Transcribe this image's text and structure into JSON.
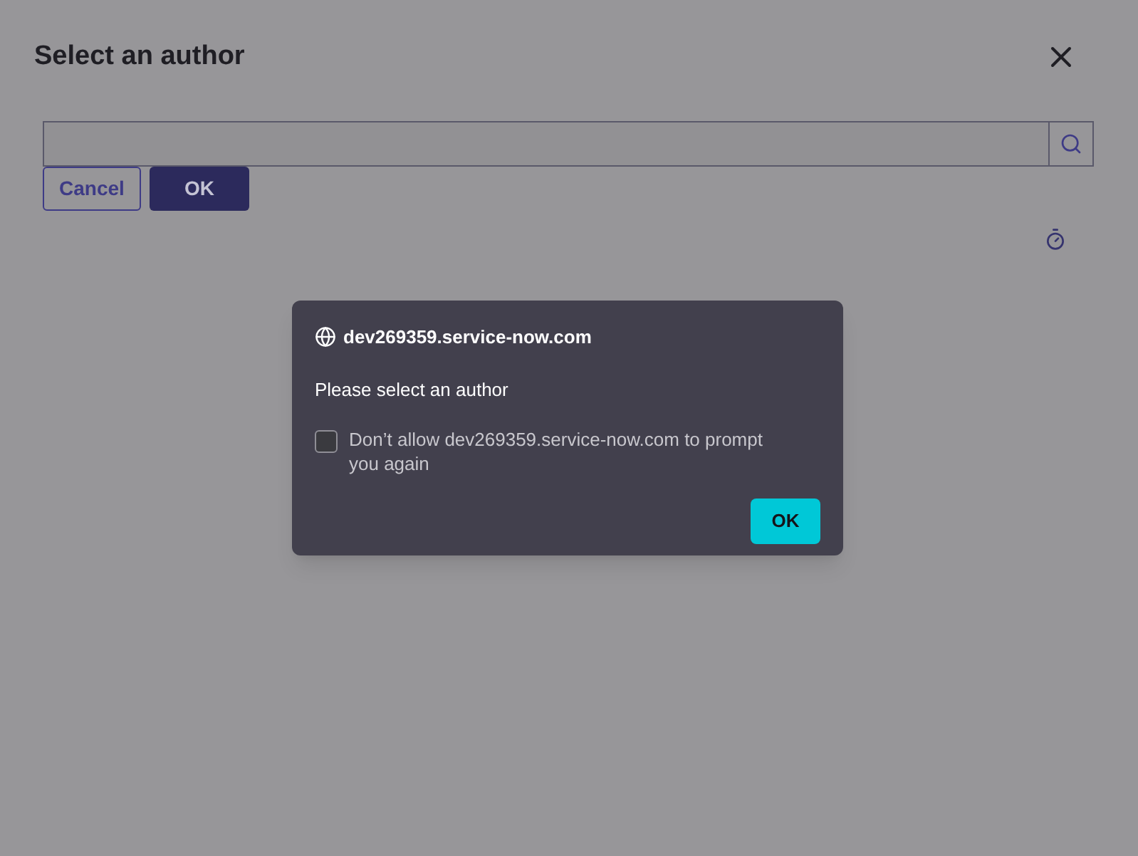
{
  "dialog": {
    "title": "Select an author",
    "buttons": [
      "Cancel",
      "OK"
    ]
  },
  "prompt": {
    "site": "dev269359.service-now.com",
    "message": "Please select an author",
    "checkbox": {
      "label": "Don’t allow dev269359.service-now.com to prompt you again",
      "checked": false
    },
    "button": "OK"
  }
}
